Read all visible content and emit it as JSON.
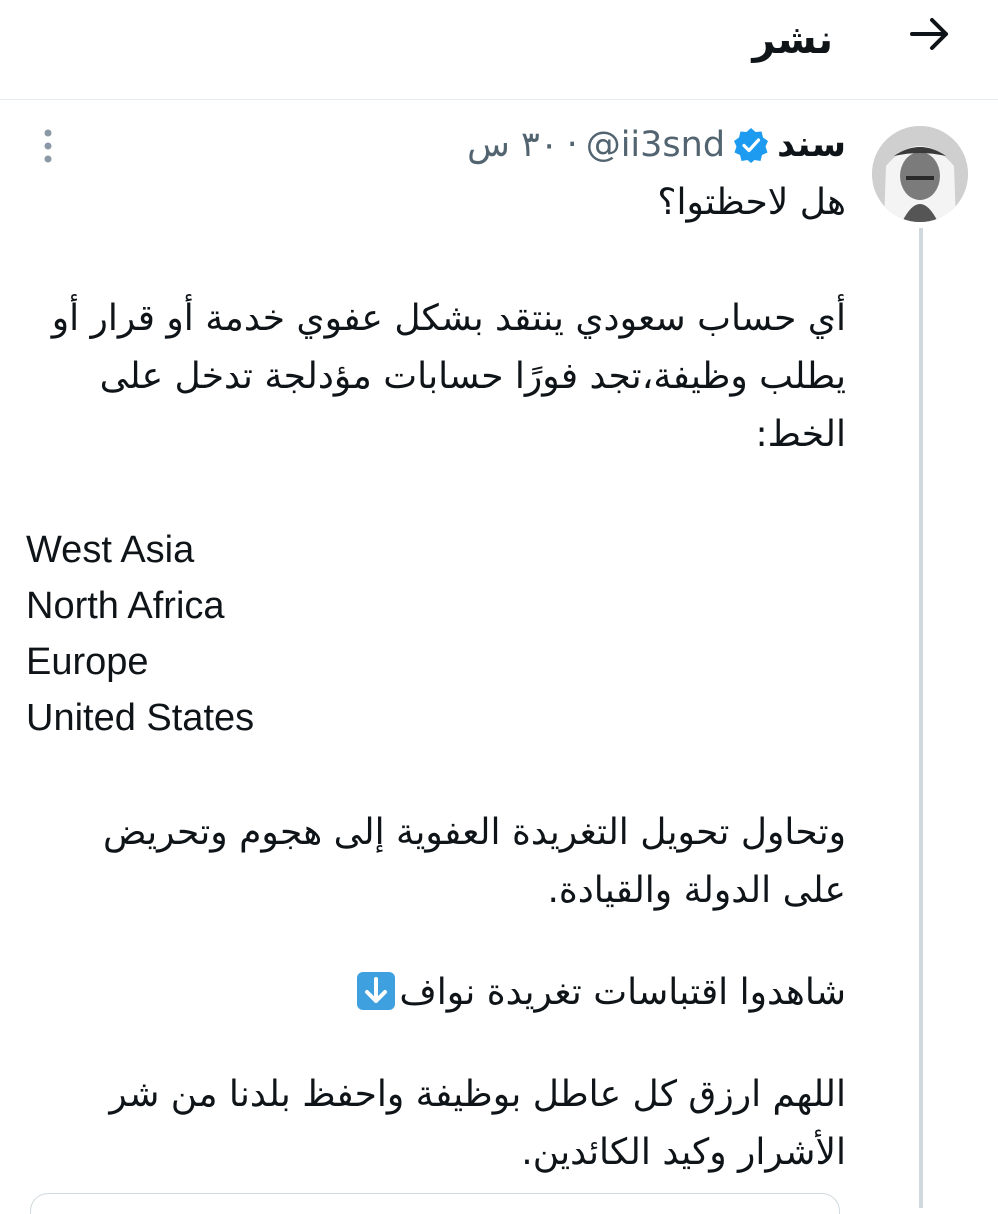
{
  "header": {
    "title": "نشر",
    "back_icon": "arrow-right-icon"
  },
  "tweet": {
    "display_name": "سند",
    "verified_icon": "verified-badge-icon",
    "handle": "@ii3snd",
    "dot": "·",
    "time": "٣٠ س",
    "more_icon": "more-vertical-icon",
    "accent_color": "#1d9bf0",
    "lines": {
      "l1": "هل لاحظتوا؟",
      "l2": "أي حساب سعودي ينتقد بشكل عفوي خدمة أو قرار أو",
      "l3": "يطلب وظيفة،تجد فورًا حسابات مؤدلجة تدخل على",
      "l4": "الخط:",
      "r1": "West Asia",
      "r2": "North Africa",
      "r3": "Europe",
      "r4": "United States",
      "l5": "وتحاول تحويل التغريدة العفوية إلى هجوم وتحريض",
      "l6": "على الدولة والقيادة.",
      "l7": "شاهدوا اقتباسات تغريدة نواف",
      "emoji": "down-arrow-emoji-icon",
      "l8": "اللهم ارزق كل عاطل بوظيفة واحفظ بلدنا من شر",
      "l9": "الأشرار وكيد الكائدين."
    }
  }
}
